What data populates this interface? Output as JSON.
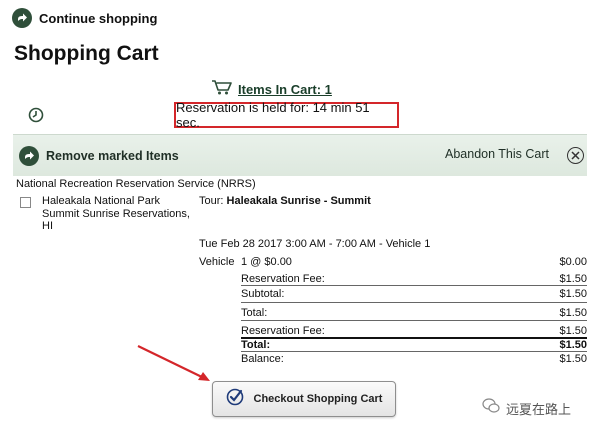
{
  "header": {
    "continue_label": "Continue shopping",
    "page_title": "Shopping Cart",
    "items_in_cart": "Items In Cart: 1",
    "reservation_hold": "Reservation is held for: 14 min 51 sec."
  },
  "action_bar": {
    "remove_label": "Remove marked Items",
    "abandon_label": "Abandon This Cart"
  },
  "cart": {
    "provider": "National Recreation Reservation Service (NRRS)",
    "item": {
      "park_name": "Haleakala National Park Summit Sunrise Reservations, HI",
      "tour_prefix": "Tour: ",
      "tour_name": "Haleakala Sunrise - Summit",
      "date_line": "Tue Feb 28 2017 3:00 AM - 7:00 AM - Vehicle 1",
      "vehicle_label": "Vehicle",
      "vehicle_qty": "1 @ $0.00",
      "vehicle_amount": "$0.00"
    },
    "lines": [
      {
        "label": "Reservation Fee:",
        "amount": "$1.50"
      },
      {
        "label": "Subtotal:",
        "amount": "$1.50"
      },
      {
        "label": "Total:",
        "amount": "$1.50"
      },
      {
        "label": "Reservation Fee:",
        "amount": "$1.50"
      },
      {
        "label": "Total:",
        "amount": "$1.50"
      },
      {
        "label": "Balance:",
        "amount": "$1.50"
      }
    ]
  },
  "checkout": {
    "label": "Checkout Shopping Cart"
  },
  "watermark": {
    "text": "远夏在路上"
  },
  "colors": {
    "accent_green": "#2f4f3a",
    "highlight_red": "#d4262a",
    "bar_bg": "#e3ece4"
  },
  "icons": [
    "circle-arrow-icon",
    "cart-icon",
    "clock-icon",
    "close-circle-icon",
    "checkmark-icon",
    "red-arrow-icon"
  ]
}
